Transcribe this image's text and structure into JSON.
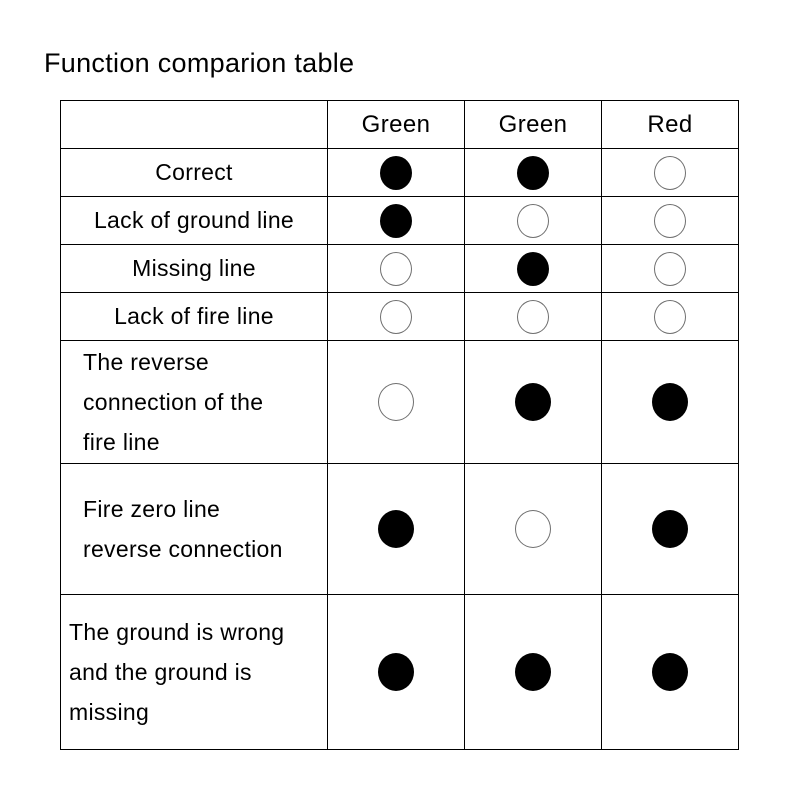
{
  "page": {
    "title": "Function comparion table",
    "background_color": "#ffffff",
    "text_color": "#000000",
    "hollow_marker_stroke": "#6f6f6f"
  },
  "table": {
    "columns": [
      {
        "key": "condition",
        "header": ""
      },
      {
        "key": "led1",
        "header": "Green"
      },
      {
        "key": "led2",
        "header": "Green"
      },
      {
        "key": "led3",
        "header": "Red"
      }
    ],
    "legend": {
      "filled": "●",
      "hollow": "○",
      "filled_meaning": "on",
      "hollow_meaning": "off"
    },
    "rows": [
      {
        "label": "Correct",
        "lines": [
          "Correct"
        ],
        "align": "center",
        "marks": [
          "filled",
          "filled",
          "hollow"
        ]
      },
      {
        "label": "Lack of ground line",
        "lines": [
          "Lack of ground line"
        ],
        "align": "center",
        "marks": [
          "filled",
          "hollow",
          "hollow"
        ]
      },
      {
        "label": "Missing line",
        "lines": [
          "Missing line"
        ],
        "align": "center",
        "marks": [
          "hollow",
          "filled",
          "hollow"
        ]
      },
      {
        "label": "Lack of fire line",
        "lines": [
          "Lack of fire line"
        ],
        "align": "center",
        "marks": [
          "hollow",
          "hollow",
          "hollow"
        ]
      },
      {
        "label": "The reverse connection of the fire line",
        "lines": [
          "The  reverse",
          "connection  of  the",
          "fire line"
        ],
        "align": "left-indent",
        "marks": [
          "hollow",
          "filled",
          "filled"
        ]
      },
      {
        "label": "Fire zero line reverse connection",
        "lines": [
          "Fire zero line",
          "reverse connection"
        ],
        "align": "left-indent",
        "marks": [
          "filled",
          "hollow",
          "filled"
        ]
      },
      {
        "label": "The ground is wrong and the ground is missing",
        "lines": [
          "The ground is wrong",
          "and the ground is",
          "missing"
        ],
        "align": "left-flush",
        "marks": [
          "filled",
          "filled",
          "filled"
        ]
      }
    ]
  }
}
